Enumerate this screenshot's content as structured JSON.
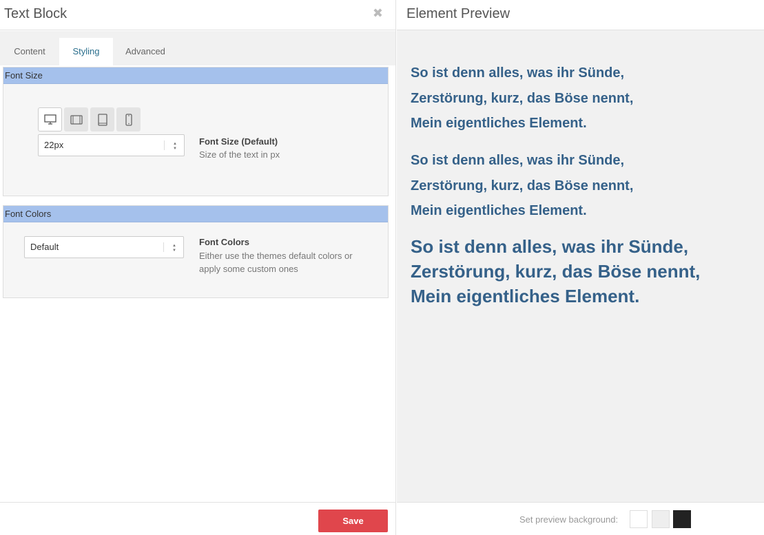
{
  "left": {
    "title": "Text Block",
    "close_icon": "close-icon",
    "tabs": [
      {
        "label": "Content",
        "active": false
      },
      {
        "label": "Styling",
        "active": true
      },
      {
        "label": "Advanced",
        "active": false
      }
    ],
    "font_size": {
      "header": "Font Size",
      "devices": [
        "desktop-icon",
        "tablet-landscape-icon",
        "tablet-portrait-icon",
        "mobile-icon"
      ],
      "active_device": "desktop",
      "value": "22px",
      "label": "Font Size (Default)",
      "help": "Size of the text in px"
    },
    "font_colors": {
      "header": "Font Colors",
      "value": "Default",
      "label": "Font Colors",
      "help_line1": "Either use the themes default colors or",
      "help_line2": "apply some custom ones"
    },
    "save_label": "Save",
    "accent_color": "#e0464c",
    "header_color": "#a5c1ec"
  },
  "right": {
    "title": "Element Preview",
    "preview_blocks": [
      [
        "So ist denn alles, was ihr Sünde,",
        "Zerstörung, kurz, das Böse nennt,",
        "Mein eigentliches Element."
      ],
      [
        "So ist denn alles, was ihr Sünde,",
        "Zerstörung, kurz, das Böse nennt,",
        "Mein eigentliches Element."
      ],
      [
        "So ist denn alles, was ihr Sünde,",
        "Zerstörung, kurz, das Böse nennt,",
        "Mein eigentliches Element."
      ]
    ],
    "preview_color": "#356189",
    "bg_label": "Set preview background:",
    "bg_swatches": [
      "#ffffff",
      "#eeeeee",
      "#222222"
    ]
  }
}
